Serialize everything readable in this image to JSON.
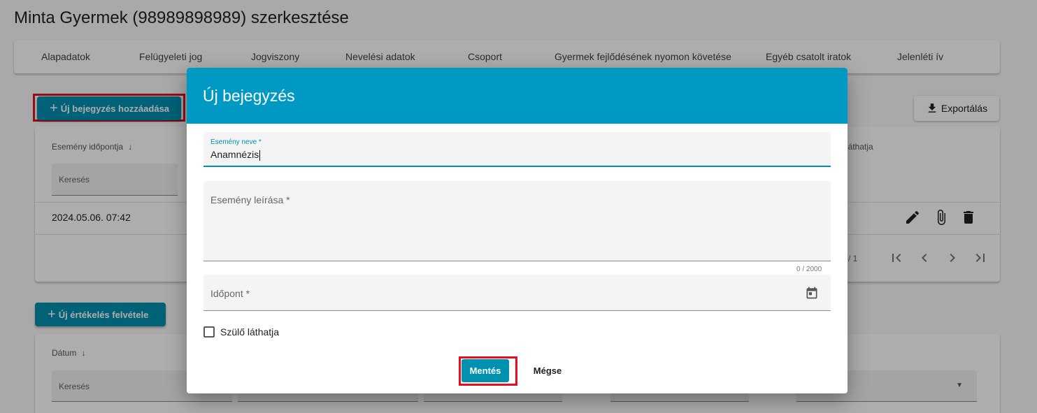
{
  "page": {
    "title": "Minta Gyermek (98989898989) szerkesztése"
  },
  "tabs": [
    {
      "label": "Alapadatok"
    },
    {
      "label": "Felügyeleti jog"
    },
    {
      "label": "Jogviszony"
    },
    {
      "label": "Nevelési adatok"
    },
    {
      "label": "Csoport"
    },
    {
      "label": "Gyermek fejlődésének nyomon követése"
    },
    {
      "label": "Egyéb csatolt iratok"
    },
    {
      "label": "Jelenléti ív"
    }
  ],
  "toolbar": {
    "add_entry_label": "Új bejegyzés hozzáadása",
    "export_label": "Exportálás",
    "add_rating_label": "Új értékelés felvétele"
  },
  "table1": {
    "col_event_time": "Esemény időpontja",
    "col_visible_partial": "láthatja",
    "search_placeholder": "Keresés",
    "rows": [
      {
        "event_time": "2024.05.06. 07:42"
      }
    ],
    "page_info_partial": "/ 1"
  },
  "table2": {
    "col_date": "Dátum",
    "search_placeholder": "Keresés"
  },
  "dialog": {
    "title": "Új bejegyzés",
    "event_name_label": "Esemény neve *",
    "event_name_value": "Anamnézis",
    "event_desc_label": "Esemény leírása *",
    "char_counter": "0 / 2000",
    "time_label": "Időpont *",
    "parent_visible_label": "Szülő láthatja",
    "parent_visible_checked": false,
    "save_label": "Mentés",
    "cancel_label": "Mégse"
  },
  "colors": {
    "accent": "#0090b0",
    "header": "#0099c4",
    "highlight": "#e01020"
  }
}
